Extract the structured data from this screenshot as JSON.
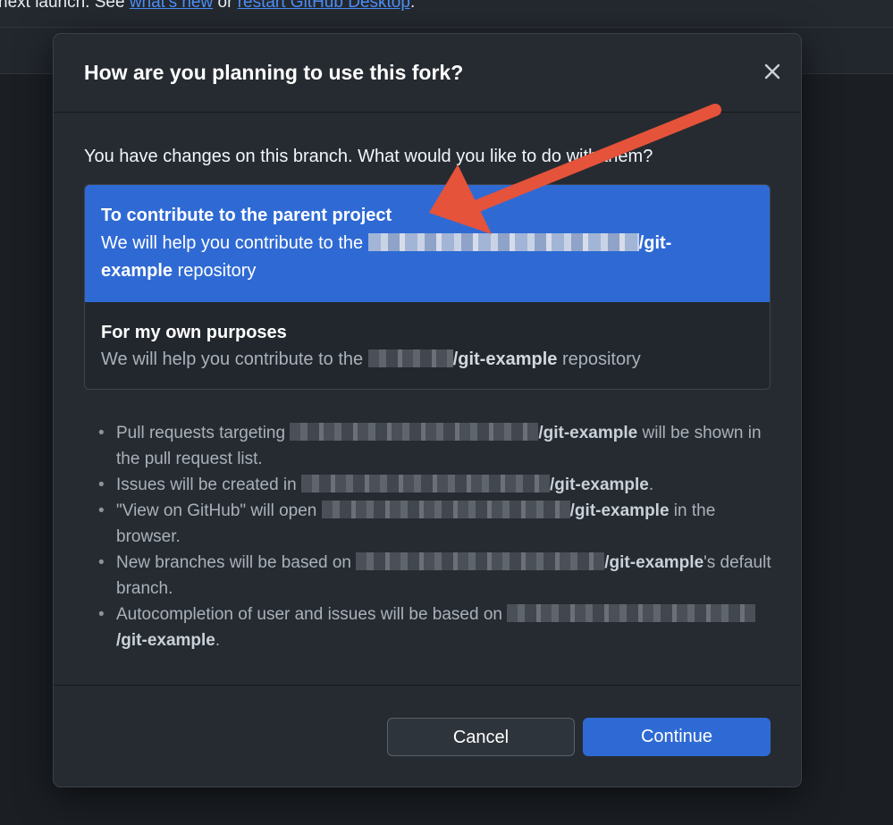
{
  "background": {
    "banner_prefix": "next launch. See ",
    "link_whats_new": "what's new",
    "banner_middle": " or ",
    "link_restart": "restart GitHub Desktop",
    "banner_suffix": "."
  },
  "dialog": {
    "title": "How are you planning to use this fork?",
    "question": "You have changes on this branch. What would you like to do with them?",
    "options": [
      {
        "title": "To contribute to the parent project",
        "desc_prefix": "We will help you contribute to the ",
        "repo": "/git-example",
        "desc_suffix": " repository",
        "selected": true
      },
      {
        "title": "For my own purposes",
        "desc_prefix": "We will help you contribute to the ",
        "repo": "/git-example",
        "desc_suffix": " repository",
        "selected": false
      }
    ],
    "bullets": [
      {
        "prefix": "Pull requests targeting ",
        "repo": "/git-example",
        "suffix": " will be shown in the pull request list."
      },
      {
        "prefix": "Issues will be created in ",
        "repo": "/git-example",
        "suffix": "."
      },
      {
        "prefix": "\"View on GitHub\" will open ",
        "repo": "/git-example",
        "suffix": " in the browser."
      },
      {
        "prefix": "New branches will be based on ",
        "repo": "/git-example",
        "suffix": "'s default branch."
      },
      {
        "prefix": "Autocompletion of user and issues will be based on ",
        "repo": "/git-example",
        "suffix": "."
      }
    ],
    "cancel_label": "Cancel",
    "continue_label": "Continue"
  },
  "colors": {
    "accent": "#2f6ad4",
    "annotation_arrow": "#e5533a",
    "dialog_bg": "#262b31"
  },
  "icons": {
    "close": "close-icon",
    "annotation": "arrow-annotation"
  }
}
